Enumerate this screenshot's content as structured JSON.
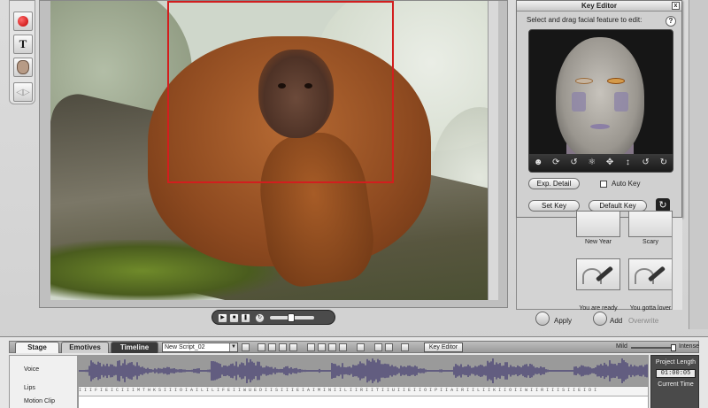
{
  "tools": {
    "icons": [
      "record-icon",
      "text-icon",
      "face-icon",
      "split-icon"
    ],
    "text_label": "T"
  },
  "key_editor": {
    "title": "Key Editor",
    "close": "x",
    "instruction": "Select and drag facial feature to edit:",
    "help": "?",
    "exp_detail": "Exp. Detail",
    "auto_key": "Auto Key",
    "set_key": "Set Key",
    "default_key": "Default Key",
    "face_tool_icons": [
      "head-icon",
      "rotate-head-icon",
      "undo-icon",
      "bone-icon",
      "move-icon",
      "down-arrow-icon",
      "undo-icon",
      "redo-icon"
    ]
  },
  "gallery": {
    "items": [
      {
        "label": "New Year"
      },
      {
        "label": "Scary"
      },
      {
        "label": "You are ready"
      },
      {
        "label": "You gotta lover"
      }
    ],
    "apply": "Apply",
    "add": "Add",
    "overwrite": "Overwrite"
  },
  "timeline": {
    "tabs": [
      "Stage",
      "Emotives",
      "Timeline"
    ],
    "script_name": "New Script_02",
    "key_editor_toggle": "Key Editor",
    "mild": "Mild",
    "intense": "Intense",
    "intensity": 0.95,
    "track_labels": [
      "Voice",
      "Lips",
      "Motion Clip"
    ],
    "lips_text": "I I I F I E I C I I I M T H K S I I I O I A I L I L I F E I I W U E D I I S I I I E I A I M I N I I L I I R I I T I I U I I E I I O I P I I A I R I I L I I K I I O I I W I I R I I I S I I E I D I",
    "project_length_label": "Project Length",
    "project_length": "01:00:05",
    "current_time_label": "Current Time"
  },
  "colors": {
    "selection": "#d21e1e",
    "waveform": "#3d3570"
  }
}
